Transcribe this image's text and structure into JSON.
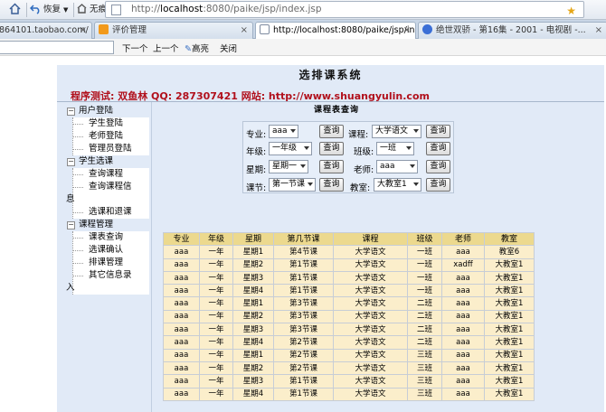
{
  "browser": {
    "nav": {
      "back_label": "恢复",
      "fav_label": "无痕"
    },
    "url_gray": "http://",
    "url_host": "localhost",
    "url_rest": ":8080/paike/jsp/index.jsp",
    "tabs": [
      {
        "label": "864101.taobao.com/",
        "icon_color": "#ffffff"
      },
      {
        "label": "评价管理",
        "icon_color": "#f29a1c"
      },
      {
        "label": "http://localhost:8080/paike/jsp/in...",
        "icon_color": "#4a7bd0"
      },
      {
        "label": "绝世双骄 - 第16集 - 2001 - 电视剧 -...",
        "icon_color": "#3b6fd6"
      }
    ],
    "findbar": {
      "next_label": "下一个",
      "prev_label": "上一个",
      "highlight_label": "高亮",
      "close_label": "关闭"
    }
  },
  "page": {
    "title": "选排课系统",
    "credit": "程序测试: 双鱼林  QQ: 287307421  网站: http://www.shuangyulin.com"
  },
  "sidebar": {
    "groups": [
      {
        "label": "用户登陆",
        "items": [
          "学生登陆",
          "老师登陆",
          "管理员登陆"
        ],
        "tail": ""
      },
      {
        "label": "学生选课",
        "items": [
          "查询课程",
          "查询课程信"
        ],
        "tail": "息",
        "items2": [
          "选课和退课"
        ]
      },
      {
        "label": "课程管理",
        "items": [
          "课表查询",
          "选课确认",
          "排课管理",
          "其它信息录"
        ],
        "tail": "入"
      }
    ]
  },
  "query": {
    "title": "课程表查询",
    "button_label": "查询",
    "major": {
      "label": "专业:",
      "value": "aaa"
    },
    "course": {
      "label": "课程:",
      "value": "大学语文"
    },
    "grade": {
      "label": "年级:",
      "value": "一年级"
    },
    "class": {
      "label": "班级:",
      "value": "一班"
    },
    "week": {
      "label": "星期:",
      "value": "星期一"
    },
    "teacher": {
      "label": "老师:",
      "value": "aaa"
    },
    "period": {
      "label": "课节:",
      "value": "第一节课"
    },
    "room": {
      "label": "教室:",
      "value": "大教室1"
    }
  },
  "table": {
    "headers": [
      "专业",
      "年级",
      "星期",
      "第几节课",
      "课程",
      "班级",
      "老师",
      "教室"
    ],
    "rows": [
      [
        "aaa",
        "一年",
        "星期1",
        "第4节课",
        "大学语文",
        "一班",
        "aaa",
        "教室6"
      ],
      [
        "aaa",
        "一年",
        "星期2",
        "第1节课",
        "大学语文",
        "一班",
        "xadff",
        "大教室1"
      ],
      [
        "aaa",
        "一年",
        "星期3",
        "第1节课",
        "大学语文",
        "一班",
        "aaa",
        "大教室1"
      ],
      [
        "aaa",
        "一年",
        "星期4",
        "第1节课",
        "大学语文",
        "一班",
        "aaa",
        "大教室1"
      ],
      [
        "aaa",
        "一年",
        "星期1",
        "第3节课",
        "大学语文",
        "二班",
        "aaa",
        "大教室1"
      ],
      [
        "aaa",
        "一年",
        "星期2",
        "第3节课",
        "大学语文",
        "二班",
        "aaa",
        "大教室1"
      ],
      [
        "aaa",
        "一年",
        "星期3",
        "第3节课",
        "大学语文",
        "二班",
        "aaa",
        "大教室1"
      ],
      [
        "aaa",
        "一年",
        "星期4",
        "第2节课",
        "大学语文",
        "二班",
        "aaa",
        "大教室1"
      ],
      [
        "aaa",
        "一年",
        "星期1",
        "第2节课",
        "大学语文",
        "三班",
        "aaa",
        "大教室1"
      ],
      [
        "aaa",
        "一年",
        "星期2",
        "第2节课",
        "大学语文",
        "三班",
        "aaa",
        "大教室1"
      ],
      [
        "aaa",
        "一年",
        "星期3",
        "第1节课",
        "大学语文",
        "三班",
        "aaa",
        "大教室1"
      ],
      [
        "aaa",
        "一年",
        "星期4",
        "第1节课",
        "大学语文",
        "三班",
        "aaa",
        "大教室1"
      ]
    ]
  }
}
